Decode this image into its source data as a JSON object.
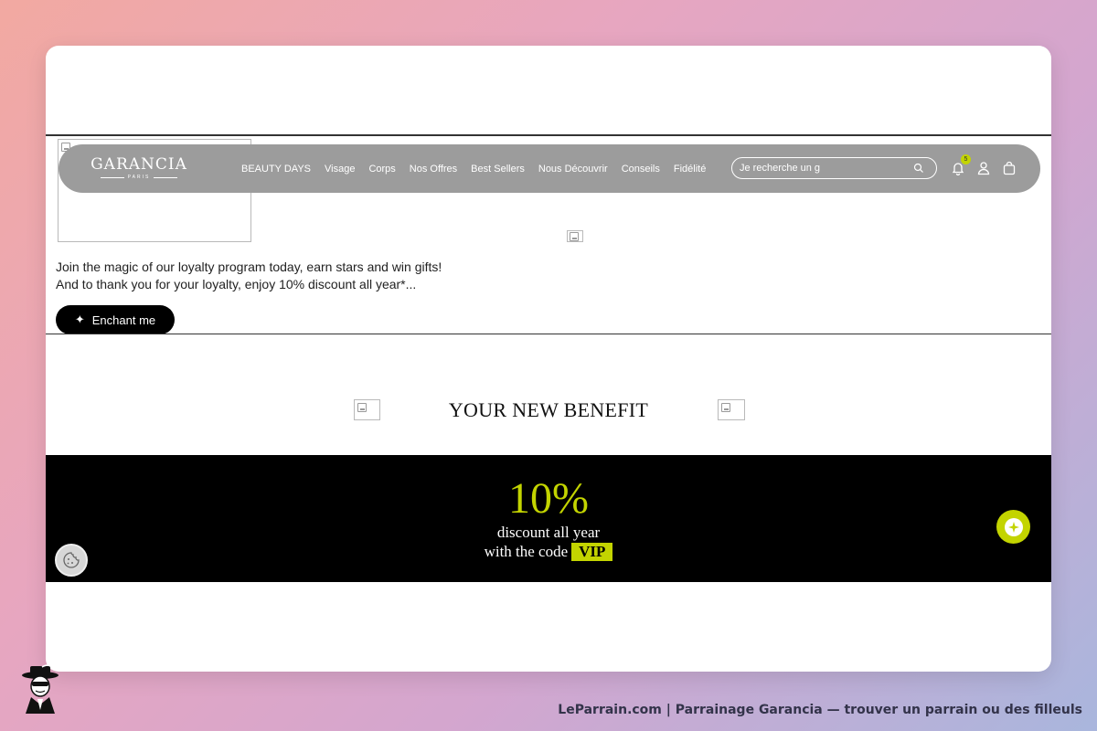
{
  "navbar": {
    "logo": {
      "name": "GARANCIA",
      "sub": "PARIS"
    },
    "menu": [
      {
        "label": "BEAUTY DAYS"
      },
      {
        "label": "Visage"
      },
      {
        "label": "Corps"
      },
      {
        "label": "Nos Offres"
      },
      {
        "label": "Best Sellers"
      },
      {
        "label": "Nous Découvrir"
      },
      {
        "label": "Conseils"
      },
      {
        "label": "Fidélité"
      }
    ],
    "search": {
      "placeholder": "Je recherche un g"
    },
    "icons": [
      "bell-icon",
      "user-icon",
      "bag-icon"
    ],
    "notification_count": "5"
  },
  "promo": {
    "line1": "Join the magic of our loyalty program today, earn stars and win gifts!",
    "line2": "And to thank you for your loyalty, enjoy 10% discount all year*...",
    "button_icon": "✦",
    "button_label": "Enchant me"
  },
  "benefit": {
    "title": "YOUR NEW BENEFIT"
  },
  "vip": {
    "percent": "10%",
    "line1": "discount all year",
    "line2": "with the code",
    "code": "VIP"
  },
  "footer": {
    "caption": "LeParrain.com | Parrainage Garancia — trouver un parrain ou des filleuls"
  },
  "colors": {
    "accent": "#c3d400",
    "navbar": "#9c9c9c",
    "band": "#000000"
  }
}
